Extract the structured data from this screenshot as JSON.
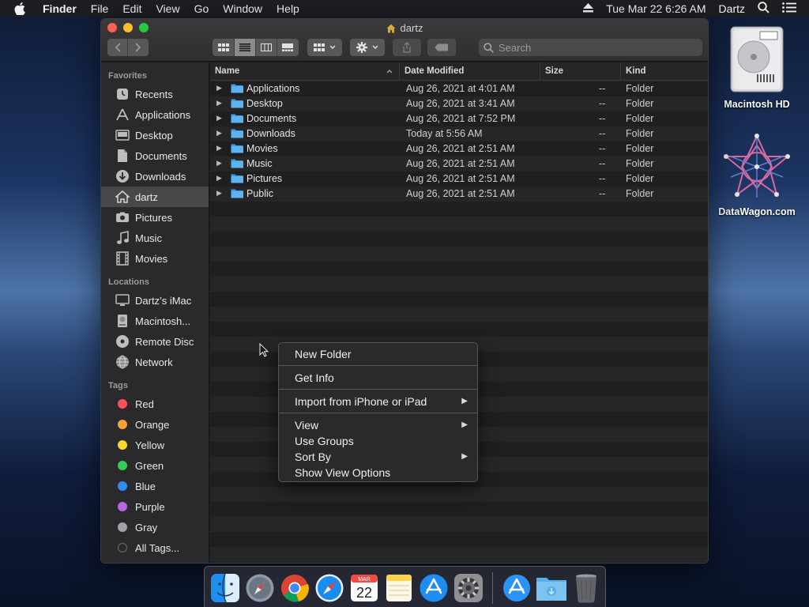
{
  "menubar": {
    "app_name": "Finder",
    "items": [
      "File",
      "Edit",
      "View",
      "Go",
      "Window",
      "Help"
    ],
    "datetime": "Tue Mar 22  6:26 AM",
    "user": "Dartz"
  },
  "desktop": {
    "icons": [
      {
        "label": "Macintosh HD"
      },
      {
        "label": "DataWagon.com"
      }
    ]
  },
  "window": {
    "title": "dartz",
    "search_placeholder": "Search"
  },
  "sidebar": {
    "favorites_header": "Favorites",
    "favorites": [
      {
        "label": "Recents",
        "icon": "recents-icon"
      },
      {
        "label": "Applications",
        "icon": "applications-icon"
      },
      {
        "label": "Desktop",
        "icon": "desktop-icon"
      },
      {
        "label": "Documents",
        "icon": "documents-icon"
      },
      {
        "label": "Downloads",
        "icon": "downloads-icon"
      },
      {
        "label": "dartz",
        "icon": "home-icon",
        "selected": true
      },
      {
        "label": "Pictures",
        "icon": "pictures-icon"
      },
      {
        "label": "Music",
        "icon": "music-icon"
      },
      {
        "label": "Movies",
        "icon": "movies-icon"
      }
    ],
    "locations_header": "Locations",
    "locations": [
      {
        "label": "Dartz’s iMac",
        "icon": "imac-icon"
      },
      {
        "label": "Macintosh...",
        "icon": "disk-icon"
      },
      {
        "label": "Remote Disc",
        "icon": "disc-icon"
      },
      {
        "label": "Network",
        "icon": "network-icon"
      }
    ],
    "tags_header": "Tags",
    "tags": [
      {
        "label": "Red",
        "color": "#ff5257"
      },
      {
        "label": "Orange",
        "color": "#f7a133"
      },
      {
        "label": "Yellow",
        "color": "#f6d530"
      },
      {
        "label": "Green",
        "color": "#34cc59"
      },
      {
        "label": "Blue",
        "color": "#2f8cf5"
      },
      {
        "label": "Purple",
        "color": "#b767e0"
      },
      {
        "label": "Gray",
        "color": "#a2a2a6"
      },
      {
        "label": "All Tags...",
        "color": "#5a5a5c"
      }
    ]
  },
  "list": {
    "columns": {
      "name": "Name",
      "date": "Date Modified",
      "size": "Size",
      "kind": "Kind"
    },
    "rows": [
      {
        "name": "Applications",
        "date": "Aug 26, 2021 at 4:01 AM",
        "size": "--",
        "kind": "Folder"
      },
      {
        "name": "Desktop",
        "date": "Aug 26, 2021 at 3:41 AM",
        "size": "--",
        "kind": "Folder"
      },
      {
        "name": "Documents",
        "date": "Aug 26, 2021 at 7:52 PM",
        "size": "--",
        "kind": "Folder"
      },
      {
        "name": "Downloads",
        "date": "Today at 5:56 AM",
        "size": "--",
        "kind": "Folder"
      },
      {
        "name": "Movies",
        "date": "Aug 26, 2021 at 2:51 AM",
        "size": "--",
        "kind": "Folder"
      },
      {
        "name": "Music",
        "date": "Aug 26, 2021 at 2:51 AM",
        "size": "--",
        "kind": "Folder"
      },
      {
        "name": "Pictures",
        "date": "Aug 26, 2021 at 2:51 AM",
        "size": "--",
        "kind": "Folder"
      },
      {
        "name": "Public",
        "date": "Aug 26, 2021 at 2:51 AM",
        "size": "--",
        "kind": "Folder"
      }
    ]
  },
  "context_menu": {
    "new_folder": "New Folder",
    "get_info": "Get Info",
    "import": "Import from iPhone or iPad",
    "view": "View",
    "use_groups": "Use Groups",
    "sort_by": "Sort By",
    "show_view_options": "Show View Options"
  },
  "dock": {
    "calendar_month": "MAR",
    "calendar_day": "22"
  }
}
